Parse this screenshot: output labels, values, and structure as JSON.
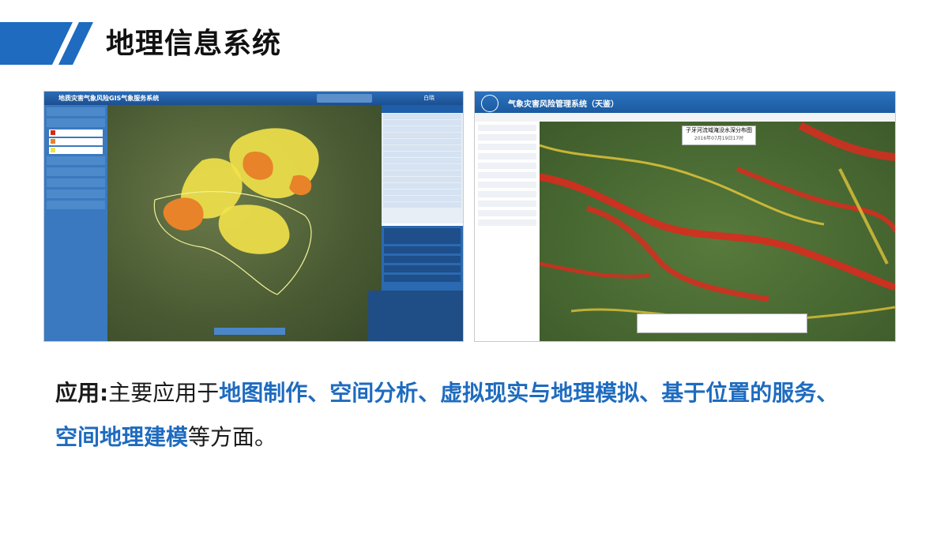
{
  "slide": {
    "title": "地理信息系统",
    "accent_color": "#1e6bbf"
  },
  "left_screenshot": {
    "app_title": "地质灾害气象风险GIS气象服务系统",
    "user_label": "白晓",
    "legend": [
      {
        "color": "#d62a1a"
      },
      {
        "color": "#e8832a"
      },
      {
        "color": "#f2e24a"
      }
    ]
  },
  "right_screenshot": {
    "app_title": "气象灾害风险管理系统（天鉴）",
    "map_caption": "子牙河流域淹没水深分布图",
    "map_caption_date": "2016年07月19日17时"
  },
  "description": {
    "lead": "应用:",
    "text1": "主要应用于",
    "highlight1": "地图制作、空间分析、虚拟现实与地理模拟、基于位置的服务、",
    "highlight2": "空间地理建模",
    "text2": "等方面。"
  }
}
